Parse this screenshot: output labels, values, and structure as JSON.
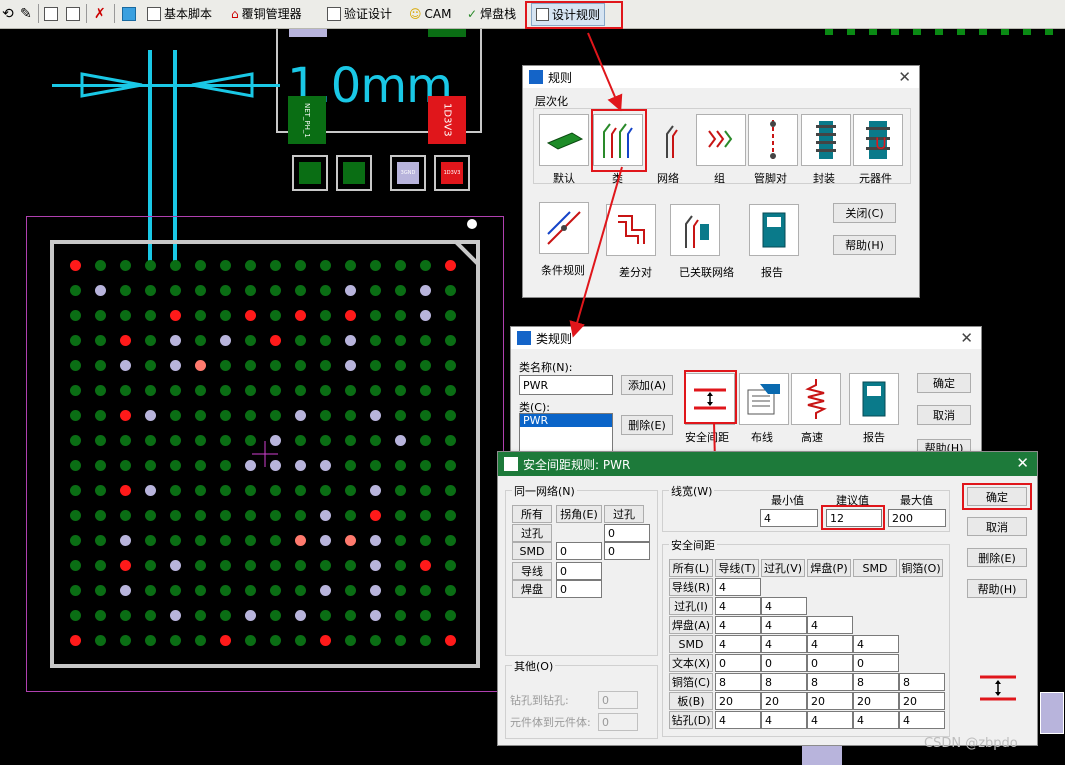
{
  "toolbar": {
    "items": [
      "基本脚本",
      "覆铜管理器",
      "验证设计",
      "CAM",
      "焊盘栈",
      "设计规则"
    ]
  },
  "pcb": {
    "dimension_label": "1.0mm",
    "net_label": "NET_PH_1",
    "comp_labels": [
      "4",
      "1D3V3",
      "3GND",
      "1D3V3"
    ]
  },
  "rules_dialog": {
    "title": "规则",
    "group": "层次化",
    "icons": [
      "默认",
      "类",
      "网络",
      "组",
      "管脚对",
      "封装",
      "元器件"
    ],
    "icons2": [
      "条件规则",
      "差分对",
      "已关联网络",
      "报告"
    ],
    "close": "关闭(C)",
    "help": "帮助(H)"
  },
  "class_dialog": {
    "title": "类规则",
    "name_label": "类名称(N):",
    "name_value": "PWR",
    "class_label": "类(C):",
    "class_items": [
      "PWR"
    ],
    "add": "添加(A)",
    "delete": "删除(E)",
    "icons": [
      "安全间距",
      "布线",
      "高速",
      "报告"
    ],
    "ok": "确定",
    "cancel": "取消",
    "help": "帮助(H)"
  },
  "clearance_dialog": {
    "title": "安全间距规则: PWR",
    "same_net": {
      "label": "同一网络(N)",
      "headers": [
        "所有",
        "拐角(E)",
        "过孔"
      ],
      "rows": [
        {
          "name": "过孔",
          "vals": [
            "",
            "0"
          ]
        },
        {
          "name": "SMD",
          "vals": [
            "0",
            "0"
          ]
        },
        {
          "name": "导线",
          "vals": [
            "0"
          ]
        },
        {
          "name": "焊盘",
          "vals": [
            "0"
          ]
        }
      ]
    },
    "other": {
      "label": "其他(O)",
      "drill_label": "钻孔到钻孔:",
      "drill_value": "0",
      "body_label": "元件体到元件体:",
      "body_value": "0"
    },
    "trace_width": {
      "label": "线宽(W)",
      "min_label": "最小值",
      "rec_label": "建议值",
      "max_label": "最大值",
      "min": "4",
      "rec": "12",
      "max": "200"
    },
    "clearance": {
      "label": "安全间距",
      "headers": [
        "所有(L)",
        "导线(T)",
        "过孔(V)",
        "焊盘(P)",
        "SMD",
        "铜箔(O)"
      ],
      "rows": [
        {
          "name": "导线(R)",
          "vals": [
            "4"
          ]
        },
        {
          "name": "过孔(I)",
          "vals": [
            "4",
            "4"
          ]
        },
        {
          "name": "焊盘(A)",
          "vals": [
            "4",
            "4",
            "4"
          ]
        },
        {
          "name": "SMD",
          "vals": [
            "4",
            "4",
            "4",
            "4"
          ]
        },
        {
          "name": "文本(X)",
          "vals": [
            "0",
            "0",
            "0",
            "0"
          ]
        },
        {
          "name": "铜箔(C)",
          "vals": [
            "8",
            "8",
            "8",
            "8",
            "8"
          ]
        },
        {
          "name": "板(B)",
          "vals": [
            "20",
            "20",
            "20",
            "20",
            "20"
          ]
        },
        {
          "name": "钻孔(D)",
          "vals": [
            "4",
            "4",
            "4",
            "4",
            "4"
          ]
        }
      ]
    },
    "ok": "确定",
    "cancel": "取消",
    "delete": "删除(E)",
    "help": "帮助(H)"
  },
  "watermark": "CSDN @zbpdo",
  "colors": {
    "pad_green": "#0a6e14",
    "pad_red": "#ff1a1a",
    "pad_lavender": "#b8b4dc",
    "pad_salmon": "#ff7a6e",
    "cyan": "#1ac8e6",
    "highlight": "#e0161b"
  }
}
